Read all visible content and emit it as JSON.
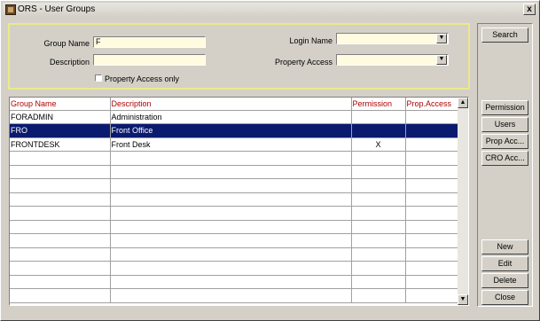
{
  "window": {
    "title": "ORS - User Groups",
    "close_label": "x"
  },
  "search": {
    "group_name_label": "Group Name",
    "group_name_value": "F",
    "description_label": "Description",
    "description_value": "",
    "login_name_label": "Login Name",
    "login_name_value": "",
    "property_access_label": "Property Access",
    "property_access_value": "",
    "property_access_only_label": "Property Access only",
    "property_access_only_checked": false
  },
  "grid": {
    "columns": [
      "Group Name",
      "Description",
      "Permission",
      "Prop.Access"
    ],
    "rows": [
      {
        "group_name": "FORADMIN",
        "description": "Administration",
        "permission": "",
        "prop_access": ""
      },
      {
        "group_name": "FRO",
        "description": "Front Office",
        "permission": "",
        "prop_access": ""
      },
      {
        "group_name": "FRONTDESK",
        "description": "Front Desk",
        "permission": "X",
        "prop_access": ""
      }
    ],
    "selected_row": 1
  },
  "buttons": {
    "search": "Search",
    "permission": "Permission",
    "users": "Users",
    "prop_acc": "Prop Acc...",
    "cro_acc": "CRO Acc...",
    "new": "New",
    "edit": "Edit",
    "delete": "Delete",
    "close": "Close"
  },
  "colors": {
    "background": "#d4d0c8",
    "field_background": "#fffbe0",
    "header_text": "#b00000",
    "selected_row": "#0a1a6e",
    "search_panel_border": "#ece98a"
  }
}
